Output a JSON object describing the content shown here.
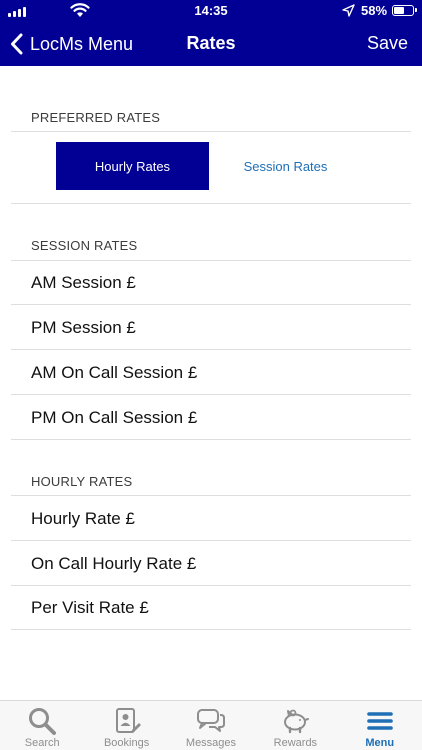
{
  "status_bar": {
    "time": "14:35",
    "battery": "58%"
  },
  "nav": {
    "back_label": "LocMs Menu",
    "title": "Rates",
    "save_label": "Save"
  },
  "preferred_rates": {
    "header": "PREFERRED RATES",
    "options": [
      {
        "label": "Hourly Rates",
        "selected": true
      },
      {
        "label": "Session Rates",
        "selected": false
      }
    ]
  },
  "session_rates": {
    "header": "SESSION RATES",
    "items": [
      {
        "label": "AM Session £"
      },
      {
        "label": "PM Session £"
      },
      {
        "label": "AM On Call Session £"
      },
      {
        "label": "PM On Call Session £"
      }
    ]
  },
  "hourly_rates": {
    "header": "HOURLY RATES",
    "items": [
      {
        "label": "Hourly Rate £"
      },
      {
        "label": "On Call Hourly Rate £"
      },
      {
        "label": "Per Visit Rate £"
      }
    ]
  },
  "tab_bar": {
    "tabs": [
      {
        "label": "Search",
        "icon": "search-icon"
      },
      {
        "label": "Bookings",
        "icon": "bookings-icon"
      },
      {
        "label": "Messages",
        "icon": "messages-icon"
      },
      {
        "label": "Rewards",
        "icon": "piggy-bank-icon"
      },
      {
        "label": "Menu",
        "icon": "menu-icon",
        "active": true
      }
    ]
  },
  "colors": {
    "brand": "#020094",
    "link": "#1f6fb6",
    "divider": "#dedede"
  }
}
